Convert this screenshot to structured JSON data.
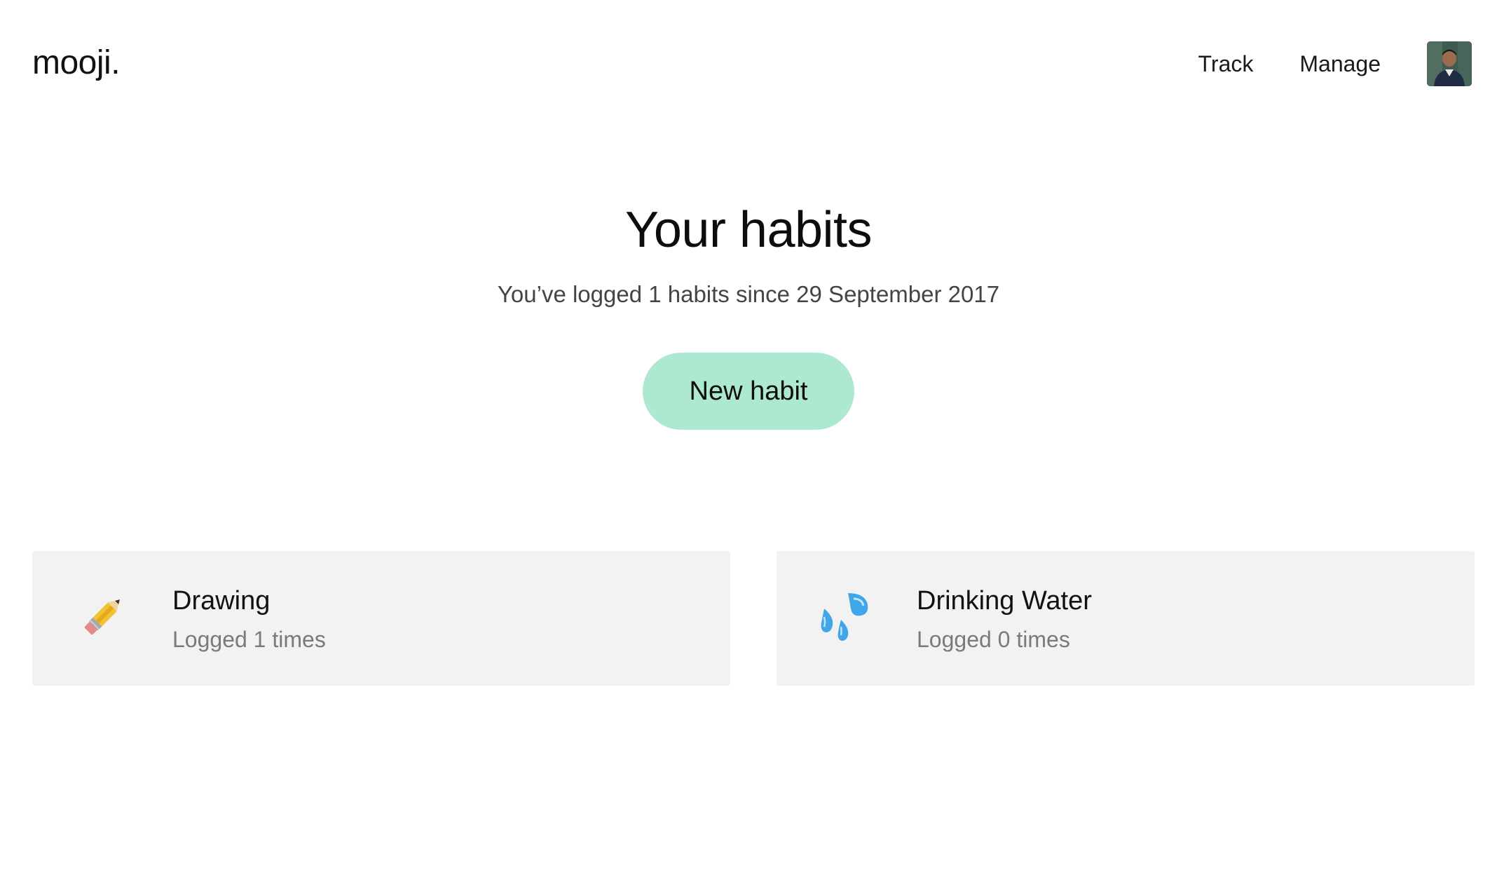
{
  "header": {
    "brand": "mooji.",
    "nav": [
      {
        "label": "Track"
      },
      {
        "label": "Manage"
      }
    ],
    "avatar_icon": "user-avatar"
  },
  "hero": {
    "title": "Your habits",
    "subtitle": "You’ve logged 1 habits since 29 September 2017",
    "new_habit_label": "New habit",
    "button_color": "#ade9d0"
  },
  "habits": [
    {
      "name": "Drawing",
      "meta": "Logged 1 times",
      "icon": "pencil-icon"
    },
    {
      "name": "Drinking Water",
      "meta": "Logged 0 times",
      "icon": "sweat-droplets-icon"
    }
  ],
  "colors": {
    "card_bg": "#f2f2f2",
    "accent": "#ade9d0",
    "muted_text": "#7a7a7a"
  }
}
